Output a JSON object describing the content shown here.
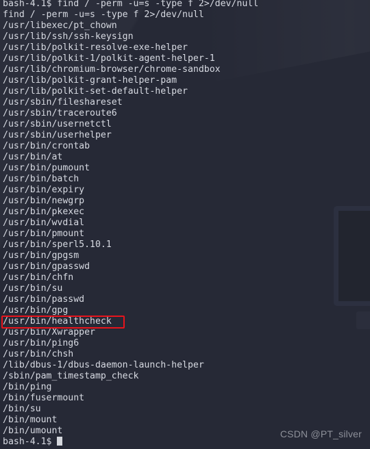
{
  "terminal": {
    "shell": "bash-4.1",
    "prompt": "bash-4.1$ ",
    "command_line": "bash-4.1$ find / -perm -u=s -type f 2>/dev/null",
    "echoed_command": "find / -perm -u=s -type f 2>/dev/null",
    "output_lines": [
      "/usr/libexec/pt_chown",
      "/usr/lib/ssh/ssh-keysign",
      "/usr/lib/polkit-resolve-exe-helper",
      "/usr/lib/polkit-1/polkit-agent-helper-1",
      "/usr/lib/chromium-browser/chrome-sandbox",
      "/usr/lib/polkit-grant-helper-pam",
      "/usr/lib/polkit-set-default-helper",
      "/usr/sbin/fileshareset",
      "/usr/sbin/traceroute6",
      "/usr/sbin/usernetctl",
      "/usr/sbin/userhelper",
      "/usr/bin/crontab",
      "/usr/bin/at",
      "/usr/bin/pumount",
      "/usr/bin/batch",
      "/usr/bin/expiry",
      "/usr/bin/newgrp",
      "/usr/bin/pkexec",
      "/usr/bin/wvdial",
      "/usr/bin/pmount",
      "/usr/bin/sperl5.10.1",
      "/usr/bin/gpgsm",
      "/usr/bin/gpasswd",
      "/usr/bin/chfn",
      "/usr/bin/su",
      "/usr/bin/passwd",
      "/usr/bin/gpg",
      "/usr/bin/healthcheck",
      "/usr/bin/Xwrapper",
      "/usr/bin/ping6",
      "/usr/bin/chsh",
      "/lib/dbus-1/dbus-daemon-launch-helper",
      "/sbin/pam_timestamp_check",
      "/bin/ping",
      "/bin/fusermount",
      "/bin/su",
      "/bin/mount",
      "/bin/umount"
    ],
    "highlighted_line": "/usr/bin/healthcheck",
    "highlighted_index": 27,
    "highlight_color": "#e8141c",
    "text_color": "#d7dae2",
    "background_color": "#262936",
    "cursor_color": "#d5d7dd"
  },
  "watermark": {
    "text": "CSDN @PT_silver",
    "color": "#8d9099"
  }
}
